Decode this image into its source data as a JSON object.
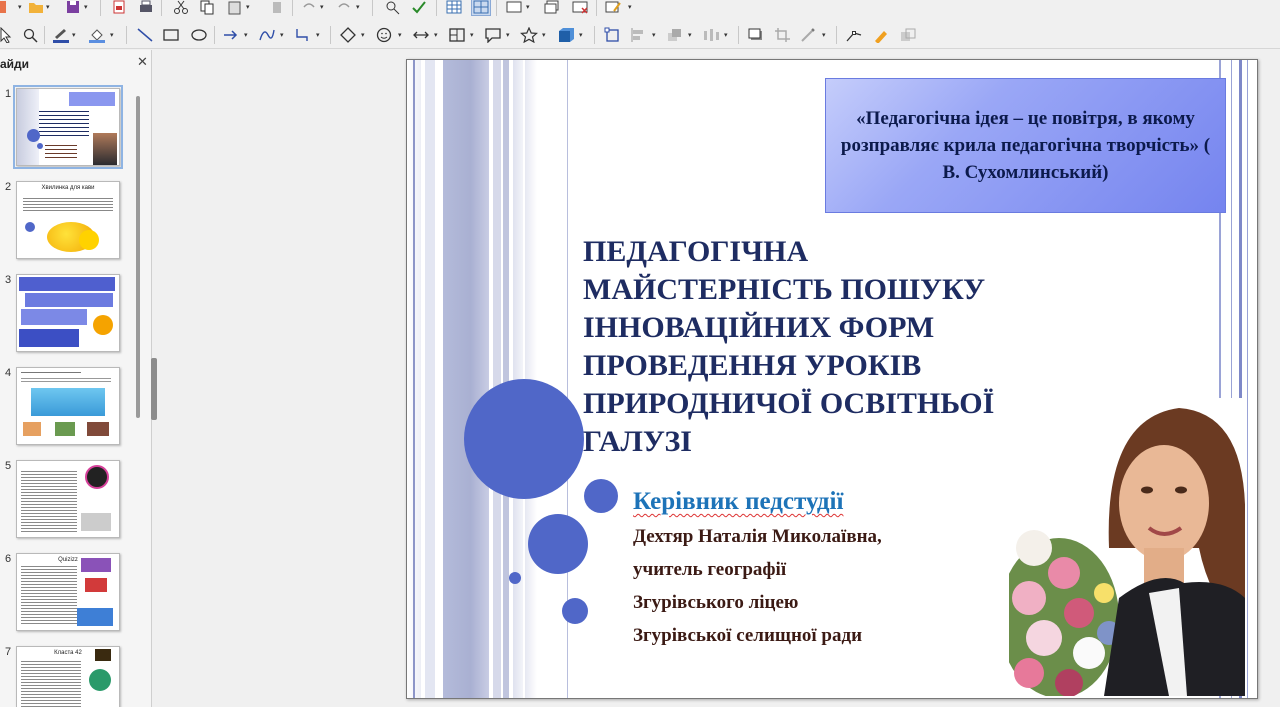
{
  "colors": {
    "accent_blue": "#5067c8",
    "title_navy": "#1e2c62",
    "subtitle_blue": "#1d73b8",
    "info_brown": "#3b1a14"
  },
  "toolbar_top": {
    "icons": [
      "new-icon",
      "open-icon",
      "save-icon",
      "export-pdf-icon",
      "print-icon",
      "cut-icon",
      "copy-icon",
      "paste-icon",
      "clone-icon",
      "undo-icon",
      "redo-icon",
      "find-replace-icon",
      "spelling-icon",
      "table-icon",
      "grid-icon",
      "slide-icon",
      "duplicate-slide-icon",
      "delete-slide-icon",
      "notes-icon"
    ]
  },
  "toolbar_draw": {
    "icons": [
      "select-icon",
      "zoom-icon",
      "line-color-icon",
      "fill-color-icon",
      "line-icon",
      "rectangle-icon",
      "ellipse-icon",
      "arrow-icon",
      "curve-icon",
      "connector-icon",
      "diamond-icon",
      "smiley-icon",
      "double-arrow-icon",
      "flowchart-icon",
      "callout-icon",
      "star-icon",
      "3d-icon",
      "transform-icon",
      "align-icon",
      "arrange-icon",
      "distribute-icon",
      "shadow-icon",
      "crop-icon",
      "filter-icon",
      "points-icon",
      "glue-icon",
      "toggle-extrusion-icon"
    ]
  },
  "slide_pane": {
    "title": "айди",
    "thumbnails": [
      {
        "number": "1",
        "mini_title": ""
      },
      {
        "number": "2",
        "mini_title": "Хвилинка для кави"
      },
      {
        "number": "3",
        "mini_title": ""
      },
      {
        "number": "4",
        "mini_title": ""
      },
      {
        "number": "5",
        "mini_title": ""
      },
      {
        "number": "6",
        "mini_title": "Quizizz"
      },
      {
        "number": "7",
        "mini_title": "Класта 42"
      }
    ]
  },
  "slide": {
    "quote": "«Педагогічна ідея – це повітря, в якому розправляє крила педагогічна творчість» ( В. Сухомлинський)",
    "title_lines": [
      "ПЕДАГОГІЧНА",
      "МАЙСТЕРНІСТЬ ПОШУКУ",
      "ІННОВАЦІЙНИХ ФОРМ",
      "ПРОВЕДЕННЯ УРОКІВ",
      "ПРИРОДНИЧОЇ ОСВІТНЬОЇ",
      "ГАЛУЗІ"
    ],
    "head_label": "Керівник педстудії",
    "info_lines": [
      "Дехтяр Наталія Миколаївна,",
      "учитель  географії",
      "Згурівського ліцею",
      "Згурівської селищної ради"
    ]
  }
}
